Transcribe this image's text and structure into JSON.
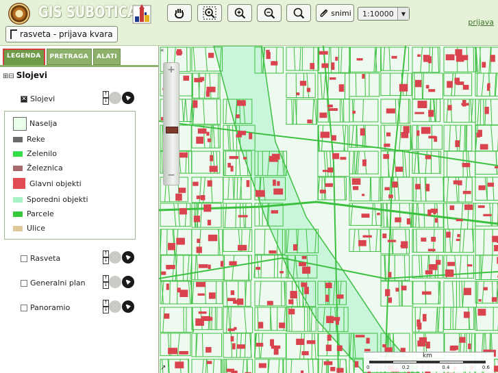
{
  "header": {
    "title": "GIS SUBOTICA",
    "login_link": "prijava",
    "report_button": "rasveta - prijava kvara",
    "snimi_label": "snimi",
    "scale_value": "1:10000",
    "tools": [
      "pan-hand-icon",
      "zoom-box-icon",
      "zoom-in-icon",
      "zoom-out-icon",
      "zoom-extent-icon",
      "snimi-icon"
    ]
  },
  "sidebar": {
    "tabs": [
      "LEGENDA",
      "PRETRAGA",
      "ALATI"
    ],
    "active_tab": "LEGENDA",
    "tree_root": "Slojevi",
    "layers": [
      {
        "name": "Slojevi",
        "checked": true
      },
      {
        "name": "Rasveta",
        "checked": false
      },
      {
        "name": "Generalni plan",
        "checked": false
      },
      {
        "name": "Panoramio",
        "checked": false
      }
    ],
    "legend": [
      {
        "label": "Naselja",
        "color": "#eaffea"
      },
      {
        "label": "Reke",
        "color": "#6b6b6b"
      },
      {
        "label": "Zelenilo",
        "color": "#33dd44"
      },
      {
        "label": "Železnica",
        "color": "#a86a6a"
      },
      {
        "label": "Glavni objekti",
        "color": "#e04b54"
      },
      {
        "label": "Sporedni objekti",
        "color": "#a8f2c6"
      },
      {
        "label": "Parcele",
        "color": "#37c83a"
      },
      {
        "label": "Ulice",
        "color": "#e0c79a"
      }
    ]
  },
  "map": {
    "scale_unit": "km",
    "scale_ticks": [
      "0",
      "0.2",
      "0.4",
      "0.6"
    ],
    "colors": {
      "background": "#eef9ef",
      "parcel": "#3cc040",
      "building": "#d9434e",
      "river": "#c9f5da"
    }
  }
}
